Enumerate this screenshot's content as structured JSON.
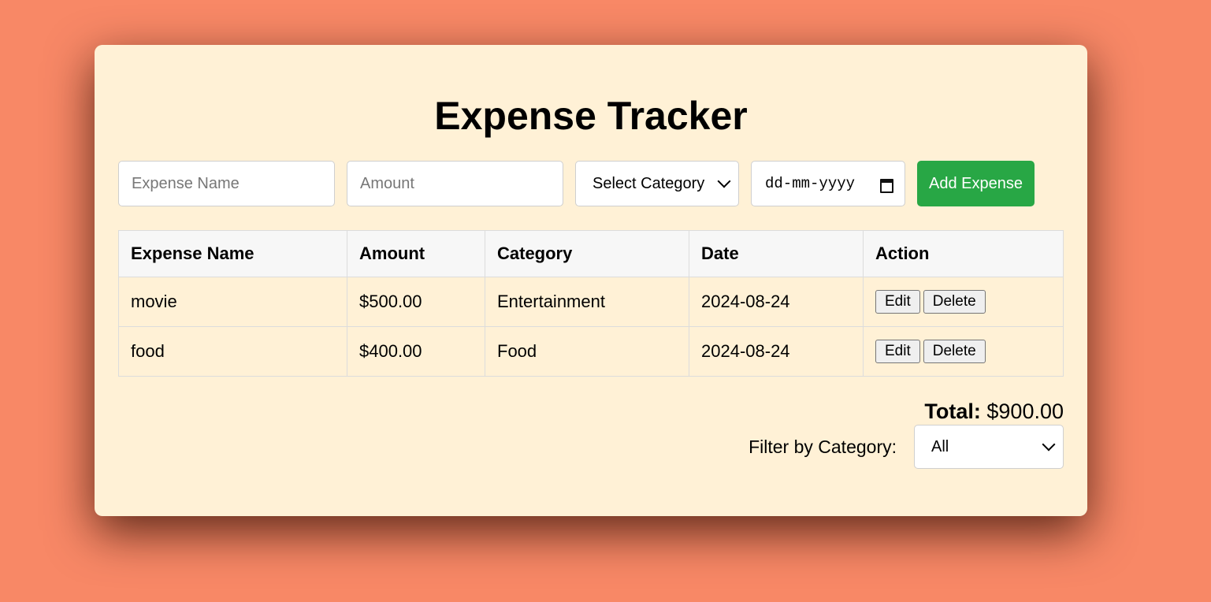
{
  "app": {
    "title": "Expense Tracker"
  },
  "form": {
    "name_placeholder": "Expense Name",
    "amount_placeholder": "Amount",
    "category_selected": "Select Category",
    "date_placeholder": "dd-mm-yyyy",
    "add_button_label": "Add Expense"
  },
  "table": {
    "headers": [
      "Expense Name",
      "Amount",
      "Category",
      "Date",
      "Action"
    ],
    "rows": [
      {
        "name": "movie",
        "amount": "$500.00",
        "category": "Entertainment",
        "date": "2024-08-24",
        "edit_label": "Edit",
        "delete_label": "Delete"
      },
      {
        "name": "food",
        "amount": "$400.00",
        "category": "Food",
        "date": "2024-08-24",
        "edit_label": "Edit",
        "delete_label": "Delete"
      }
    ]
  },
  "summary": {
    "total_label": "Total:",
    "total_value": "$900.00"
  },
  "filter": {
    "label": "Filter by Category:",
    "selected": "All"
  },
  "colors": {
    "page_background": "#f88866",
    "card_background": "#fff1d6",
    "add_button": "#28a745"
  },
  "icons": {
    "select_arrow": "chevron-down-icon",
    "date_picker": "calendar-icon"
  }
}
